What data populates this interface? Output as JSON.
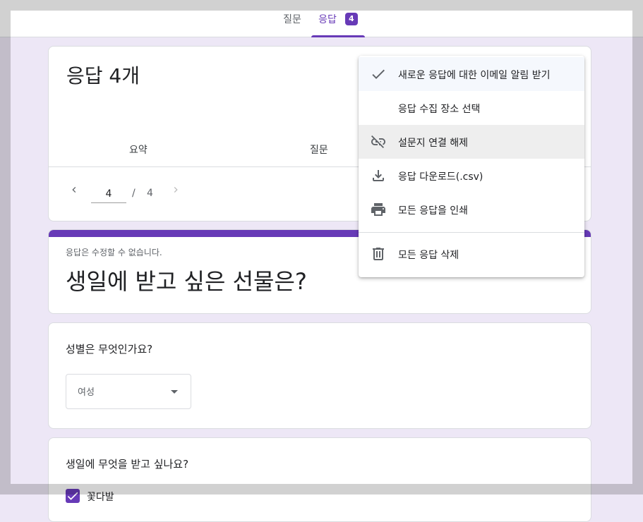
{
  "tabs": [
    {
      "label": "질문"
    },
    {
      "label": "응답",
      "badge": "4"
    }
  ],
  "summary": {
    "title": "응답 4개",
    "subtabs": [
      "요약",
      "질문"
    ],
    "pager": {
      "current": "4",
      "separator": "/",
      "total": "4"
    }
  },
  "form": {
    "note": "응답은 수정할 수 없습니다.",
    "title": "생일에 받고 싶은 선물은?"
  },
  "questions": [
    {
      "title": "성별은 무엇인가요?",
      "answer": "여성"
    },
    {
      "title": "생일에 무엇을 받고 싶나요?",
      "answer": "꽃다발"
    }
  ],
  "menu": {
    "items": [
      {
        "label": "새로운 응답에 대한 이메일 알림 받기",
        "icon": "check-icon",
        "checked": true
      },
      {
        "label": "응답 수집 장소 선택",
        "icon": ""
      },
      {
        "label": "설문지 연결 해제",
        "icon": "link-off-icon"
      },
      {
        "label": "응답 다운로드(.csv)",
        "icon": "download-icon"
      },
      {
        "label": "모든 응답을 인쇄",
        "icon": "print-icon"
      },
      {
        "label": "모든 응답 삭제",
        "icon": "trash-icon"
      }
    ]
  },
  "colors": {
    "accent": "#673ab7",
    "background": "#ede7f6"
  }
}
